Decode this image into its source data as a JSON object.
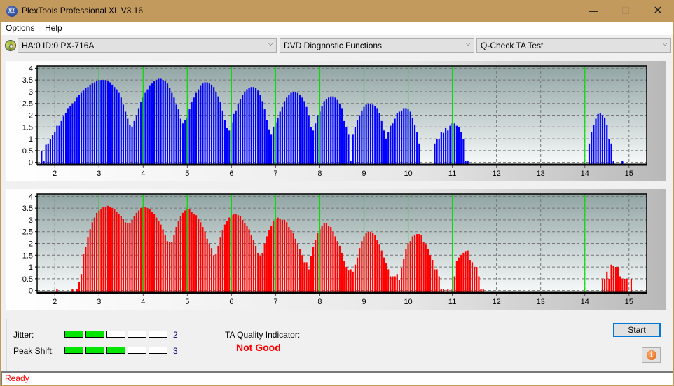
{
  "window": {
    "title": "PlexTools Professional XL V3.16",
    "app_icon_text": "XL",
    "controls": {
      "minimize": "—",
      "maximize": "☐",
      "close": "✕"
    }
  },
  "menu": {
    "items": [
      "Options",
      "Help"
    ]
  },
  "toolbar": {
    "drive": "HA:0 ID:0  PX-716A",
    "function": "DVD Diagnostic Functions",
    "test": "Q-Check TA Test",
    "arrow": "⌵"
  },
  "results": {
    "jitter_label": "Jitter:",
    "jitter_value": 2,
    "jitter_max": 5,
    "peak_shift_label": "Peak Shift:",
    "peak_shift_value": 3,
    "peak_shift_max": 5,
    "ta_quality_label": "TA Quality Indicator:",
    "ta_quality_value": "Not Good"
  },
  "buttons": {
    "start": "Start",
    "info": "i"
  },
  "status": {
    "text": "Ready"
  },
  "colors": {
    "top_series": "#0000ff",
    "bottom_series": "#ff0000",
    "marker_lines": "#00e000",
    "meter_on": "#00e600",
    "quality_text": "#ff0000"
  },
  "chart_data": [
    {
      "type": "bar",
      "name": "Top TA distribution (blue)",
      "xlim": [
        1.6,
        15.4
      ],
      "ylim": [
        -0.1,
        4.1
      ],
      "xticks": [
        2,
        3,
        4,
        5,
        6,
        7,
        8,
        9,
        10,
        11,
        12,
        13,
        14,
        15
      ],
      "yticks": [
        "0",
        "0.5",
        "1",
        "1.5",
        "2",
        "2.5",
        "3",
        "3.5",
        "4"
      ],
      "grid": true,
      "marker_lines_x": [
        3,
        4,
        5,
        6,
        7,
        8,
        9,
        10,
        11,
        14
      ],
      "x_start": 1.7,
      "x_step": 0.05,
      "values": [
        0.5,
        0.05,
        0.75,
        0.8,
        1.0,
        1.15,
        1.3,
        1.55,
        1.55,
        1.75,
        1.95,
        2.1,
        2.3,
        2.4,
        2.5,
        2.6,
        2.75,
        2.85,
        2.95,
        3.05,
        3.15,
        3.2,
        3.3,
        3.35,
        3.4,
        3.45,
        3.5,
        3.5,
        3.5,
        3.5,
        3.45,
        3.4,
        3.3,
        3.2,
        3.1,
        2.95,
        2.75,
        2.45,
        2.15,
        1.85,
        1.6,
        1.5,
        1.75,
        2.0,
        2.3,
        2.55,
        2.75,
        2.95,
        3.1,
        3.25,
        3.35,
        3.45,
        3.5,
        3.55,
        3.55,
        3.5,
        3.45,
        3.35,
        3.15,
        2.95,
        2.75,
        2.45,
        2.25,
        1.85,
        1.65,
        1.8,
        1.9,
        2.25,
        2.55,
        2.75,
        2.95,
        3.1,
        3.25,
        3.35,
        3.4,
        3.4,
        3.35,
        3.3,
        3.2,
        3.0,
        2.8,
        2.55,
        2.2,
        1.8,
        1.45,
        1.35,
        1.7,
        2.05,
        2.2,
        2.5,
        2.7,
        2.85,
        3.0,
        3.1,
        3.15,
        3.2,
        3.2,
        3.15,
        3.05,
        2.85,
        2.6,
        2.25,
        1.8,
        1.4,
        1.2,
        1.5,
        1.7,
        1.9,
        2.15,
        2.35,
        2.6,
        2.75,
        2.85,
        2.95,
        3.0,
        3.0,
        2.95,
        2.85,
        2.75,
        2.6,
        2.35,
        2.0,
        1.5,
        1.35,
        1.65,
        2.0,
        2.15,
        2.4,
        2.6,
        2.7,
        2.75,
        2.8,
        2.8,
        2.75,
        2.65,
        2.5,
        2.3,
        1.75,
        1.5,
        1.2,
        0.05,
        1.2,
        1.5,
        1.8,
        2.0,
        2.2,
        2.35,
        2.45,
        2.5,
        2.5,
        2.45,
        2.4,
        2.3,
        2.1,
        1.75,
        1.35,
        1.0,
        1.3,
        1.55,
        1.65,
        1.85,
        2.1,
        2.15,
        2.2,
        2.3,
        2.3,
        2.25,
        2.15,
        1.9,
        1.6,
        1.3,
        0.8,
        0,
        0,
        0,
        0,
        0,
        0,
        0.8,
        1.0,
        1.0,
        1.3,
        1.25,
        1.45,
        1.35,
        1.55,
        1.65,
        1.65,
        1.55,
        1.5,
        1.3,
        1.0,
        0.05,
        0.05,
        0,
        0,
        0,
        0,
        0,
        0,
        0,
        0,
        0,
        0,
        0,
        0,
        0,
        0,
        0,
        0,
        0,
        0,
        0,
        0,
        0,
        0,
        0,
        0,
        0,
        0,
        0,
        0,
        0,
        0,
        0,
        0,
        0,
        0,
        0,
        0,
        0,
        0,
        0,
        0,
        0,
        0,
        0,
        0,
        0,
        0,
        0,
        0,
        0,
        0,
        0,
        0,
        0,
        0,
        0.8,
        1.3,
        1.6,
        1.85,
        2.05,
        2.1,
        2.0,
        1.9,
        1.6,
        1.0,
        0.8,
        0.05,
        0,
        0,
        0,
        0.05
      ]
    },
    {
      "type": "bar",
      "name": "Bottom TA distribution (red)",
      "xlim": [
        1.6,
        15.4
      ],
      "ylim": [
        -0.1,
        4.1
      ],
      "xticks": [
        2,
        3,
        4,
        5,
        6,
        7,
        8,
        9,
        10,
        11,
        12,
        13,
        14,
        15
      ],
      "yticks": [
        "0",
        "0.5",
        "1",
        "1.5",
        "2",
        "2.5",
        "3",
        "3.5",
        "4"
      ],
      "grid": true,
      "marker_lines_x": [
        3,
        4,
        5,
        6,
        7,
        8,
        9,
        10,
        11,
        14
      ],
      "x_start": 1.7,
      "x_step": 0.05,
      "values": [
        0,
        0,
        0,
        0,
        0,
        0,
        0,
        0.05,
        0,
        0,
        0,
        0,
        0,
        0,
        0.05,
        0,
        0.05,
        0.35,
        0.7,
        1.55,
        1.85,
        2.25,
        2.6,
        2.9,
        3.1,
        3.3,
        3.4,
        3.45,
        3.55,
        3.55,
        3.6,
        3.55,
        3.5,
        3.45,
        3.35,
        3.25,
        3.15,
        3.05,
        2.9,
        2.85,
        2.85,
        3.0,
        3.15,
        3.3,
        3.4,
        3.5,
        3.55,
        3.55,
        3.5,
        3.45,
        3.35,
        3.25,
        3.1,
        2.95,
        2.8,
        2.6,
        2.35,
        2.1,
        2.05,
        2.05,
        2.35,
        2.7,
        2.95,
        3.15,
        3.3,
        3.4,
        3.45,
        3.45,
        3.35,
        3.25,
        3.2,
        3.05,
        2.9,
        2.7,
        2.5,
        2.2,
        2.0,
        1.8,
        1.5,
        1.55,
        1.9,
        2.25,
        2.55,
        2.8,
        2.95,
        3.1,
        3.2,
        3.25,
        3.25,
        3.2,
        3.15,
        3.0,
        2.85,
        2.75,
        2.6,
        2.35,
        2.15,
        1.9,
        1.6,
        1.45,
        1.6,
        2.0,
        2.3,
        2.55,
        2.75,
        2.95,
        3.05,
        3.1,
        3.05,
        3.0,
        3.0,
        2.9,
        2.7,
        2.55,
        2.45,
        2.2,
        2.0,
        1.75,
        1.5,
        1.2,
        1.2,
        0.9,
        1.45,
        1.85,
        2.15,
        2.45,
        2.6,
        2.75,
        2.85,
        2.85,
        2.75,
        2.7,
        2.5,
        2.3,
        2.1,
        1.9,
        1.6,
        1.25,
        1.0,
        0.85,
        0.9,
        0.8,
        1.1,
        1.4,
        1.8,
        2.1,
        2.3,
        2.45,
        2.5,
        2.5,
        2.45,
        2.35,
        2.15,
        1.95,
        1.7,
        1.4,
        1.15,
        0.9,
        0.6,
        0.6,
        0.6,
        0.7,
        0.45,
        0.95,
        1.35,
        1.75,
        2.0,
        2.1,
        2.3,
        2.35,
        2.4,
        2.4,
        2.35,
        2.05,
        1.95,
        1.75,
        1.5,
        1.3,
        0.9,
        0.9,
        0.6,
        0.05,
        0.05,
        0,
        0.05,
        0,
        0.05,
        0.6,
        1.25,
        1.4,
        1.5,
        1.6,
        1.65,
        1.7,
        1.3,
        1.2,
        1.0,
        1.0,
        0.6,
        0.05,
        0.05,
        0,
        0,
        0,
        0,
        0,
        0,
        0,
        0,
        0,
        0,
        0,
        0,
        0,
        0,
        0,
        0,
        0,
        0,
        0,
        0,
        0,
        0,
        0,
        0,
        0,
        0,
        0,
        0,
        0,
        0,
        0,
        0,
        0,
        0,
        0,
        0,
        0,
        0,
        0,
        0,
        0,
        0,
        0,
        0,
        0,
        0,
        0,
        0,
        0,
        0,
        0,
        0,
        0,
        0.5,
        0.5,
        0.8,
        0.5,
        1.1,
        1.05,
        1.0,
        1.0,
        0.6,
        0.5,
        0.5,
        0.5,
        0,
        0.5
      ]
    }
  ]
}
